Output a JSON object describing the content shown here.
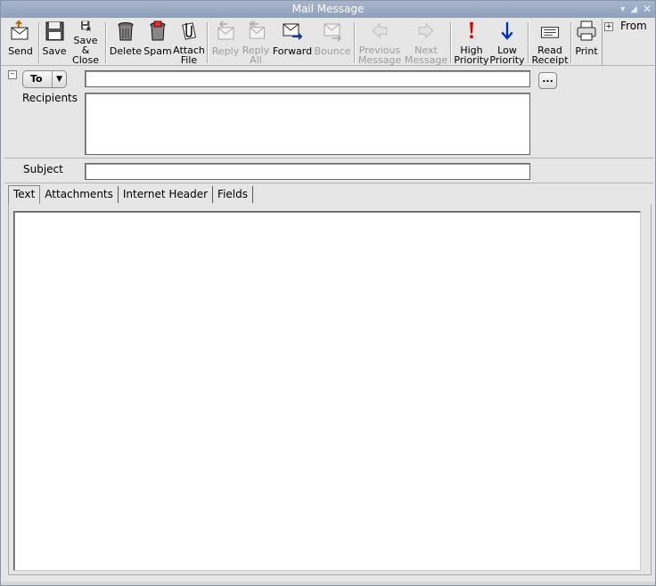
{
  "window": {
    "title": "Mail Message",
    "controls": [
      "minimize",
      "maximize",
      "close"
    ]
  },
  "toolbar": {
    "send": "Send",
    "save": "Save",
    "save_close": "Save &\nClose",
    "delete": "Delete",
    "spam": "Spam",
    "attach": "Attach\nFile",
    "reply": "Reply",
    "reply_all": "Reply\nAll",
    "forward": "Forward",
    "bounce": "Bounce",
    "previous": "Previous\nMessage",
    "next": "Next\nMessage",
    "high_priority": "High\nPriority",
    "low_priority": "Low\nPriority",
    "read_receipt": "Read\nReceipt",
    "print": "Print",
    "from": "From"
  },
  "header": {
    "to_select": "To",
    "recipients_label": "Recipients",
    "more_button": "...",
    "subject_label": "Subject",
    "to_value": "",
    "subject_value": ""
  },
  "tabs": [
    {
      "label": "Text",
      "active": true
    },
    {
      "label": "Attachments",
      "active": false
    },
    {
      "label": "Internet Header",
      "active": false
    },
    {
      "label": "Fields",
      "active": false
    }
  ],
  "body": {
    "text": ""
  },
  "colors": {
    "titlebar": "#95a5bd",
    "background": "#e6e6e6",
    "high_priority": "#e00000",
    "low_priority": "#0028c8"
  }
}
